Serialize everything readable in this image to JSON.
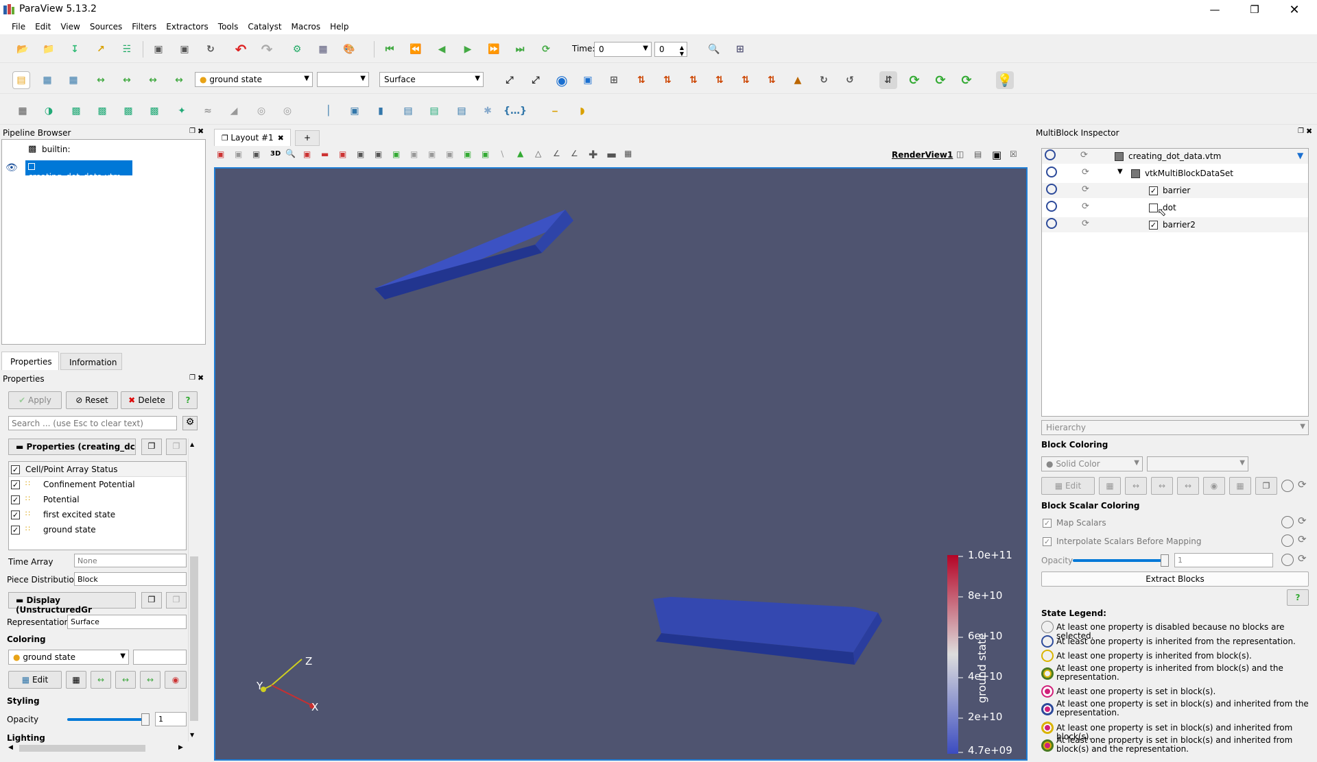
{
  "window": {
    "title": "ParaView 5.13.2"
  },
  "menu": [
    "File",
    "Edit",
    "View",
    "Sources",
    "Filters",
    "Extractors",
    "Tools",
    "Catalyst",
    "Macros",
    "Help"
  ],
  "time": {
    "label": "Time:",
    "value": "0",
    "index": "0"
  },
  "toolbar2": {
    "array_combo": "ground state",
    "rep_combo": "Surface"
  },
  "pipeline": {
    "title": "Pipeline Browser",
    "items": [
      "builtin:",
      "creating_dot_data.vtm"
    ]
  },
  "layout": {
    "tab": "Layout #1",
    "add": "+",
    "view_label": "RenderView1",
    "mode_3d": "3D"
  },
  "prop_tabs": [
    "Properties",
    "Information"
  ],
  "properties": {
    "title": "Properties",
    "apply": "Apply",
    "reset": "Reset",
    "delete": "Delete",
    "help": "?",
    "search_placeholder": "Search ... (use Esc to clear text)",
    "section1": "Properties (creating_dc",
    "arrays_header": "Cell/Point Array Status",
    "arrays": [
      "Confinement Potential",
      "Potential",
      "first excited state",
      "ground state"
    ],
    "time_array_label": "Time Array",
    "time_array_value": "None",
    "piece_label": "Piece Distribution",
    "piece_value": "Block",
    "section2": "Display (UnstructuredGr",
    "rep_label": "Representation",
    "rep_value": "Surface",
    "coloring_label": "Coloring",
    "coloring_value": "ground state",
    "edit": "Edit",
    "styling_label": "Styling",
    "opacity_label": "Opacity",
    "opacity_value": "1",
    "lighting_label": "Lighting"
  },
  "colorbar": {
    "title": "ground state",
    "ticks": [
      "1.0e+11",
      "8e+10",
      "6e+10",
      "4e+10",
      "2e+10",
      "4.7e+09"
    ]
  },
  "axes": {
    "x": "X",
    "y": "Y",
    "z": "Z"
  },
  "inspector": {
    "title": "MultiBlock Inspector",
    "tree": [
      {
        "label": "creating_dot_data.vtm",
        "checked": false
      },
      {
        "label": "vtkMultiBlockDataSet",
        "checked": false
      },
      {
        "label": "barrier",
        "checked": true
      },
      {
        "label": "dot",
        "checked": false
      },
      {
        "label": "barrier2",
        "checked": true
      }
    ],
    "mode": "Hierarchy",
    "block_coloring": "Block Coloring",
    "solid_color": "Solid Color",
    "edit": "Edit",
    "block_scalar_coloring": "Block Scalar Coloring",
    "map_scalars": "Map Scalars",
    "interpolate": "Interpolate Scalars Before Mapping",
    "opacity_label": "Opacity",
    "opacity_value": "1",
    "extract": "Extract Blocks",
    "legend_title": "State Legend:",
    "legend": [
      "At least one property is disabled because no blocks are selected.",
      "At least one property is inherited from the representation.",
      "At least one property is inherited from block(s).",
      "At least one property is inherited from block(s) and the representation.",
      "At least one property is set in block(s).",
      "At least one property is set in block(s) and inherited from the representation.",
      "At least one property is set in block(s) and inherited from block(s).",
      "At least one property is set in block(s) and inherited from block(s) and the representation."
    ]
  },
  "colors": {
    "render_bg": "#4f5470",
    "slab": "#2c3f9c",
    "highlight": "#0078d7"
  }
}
